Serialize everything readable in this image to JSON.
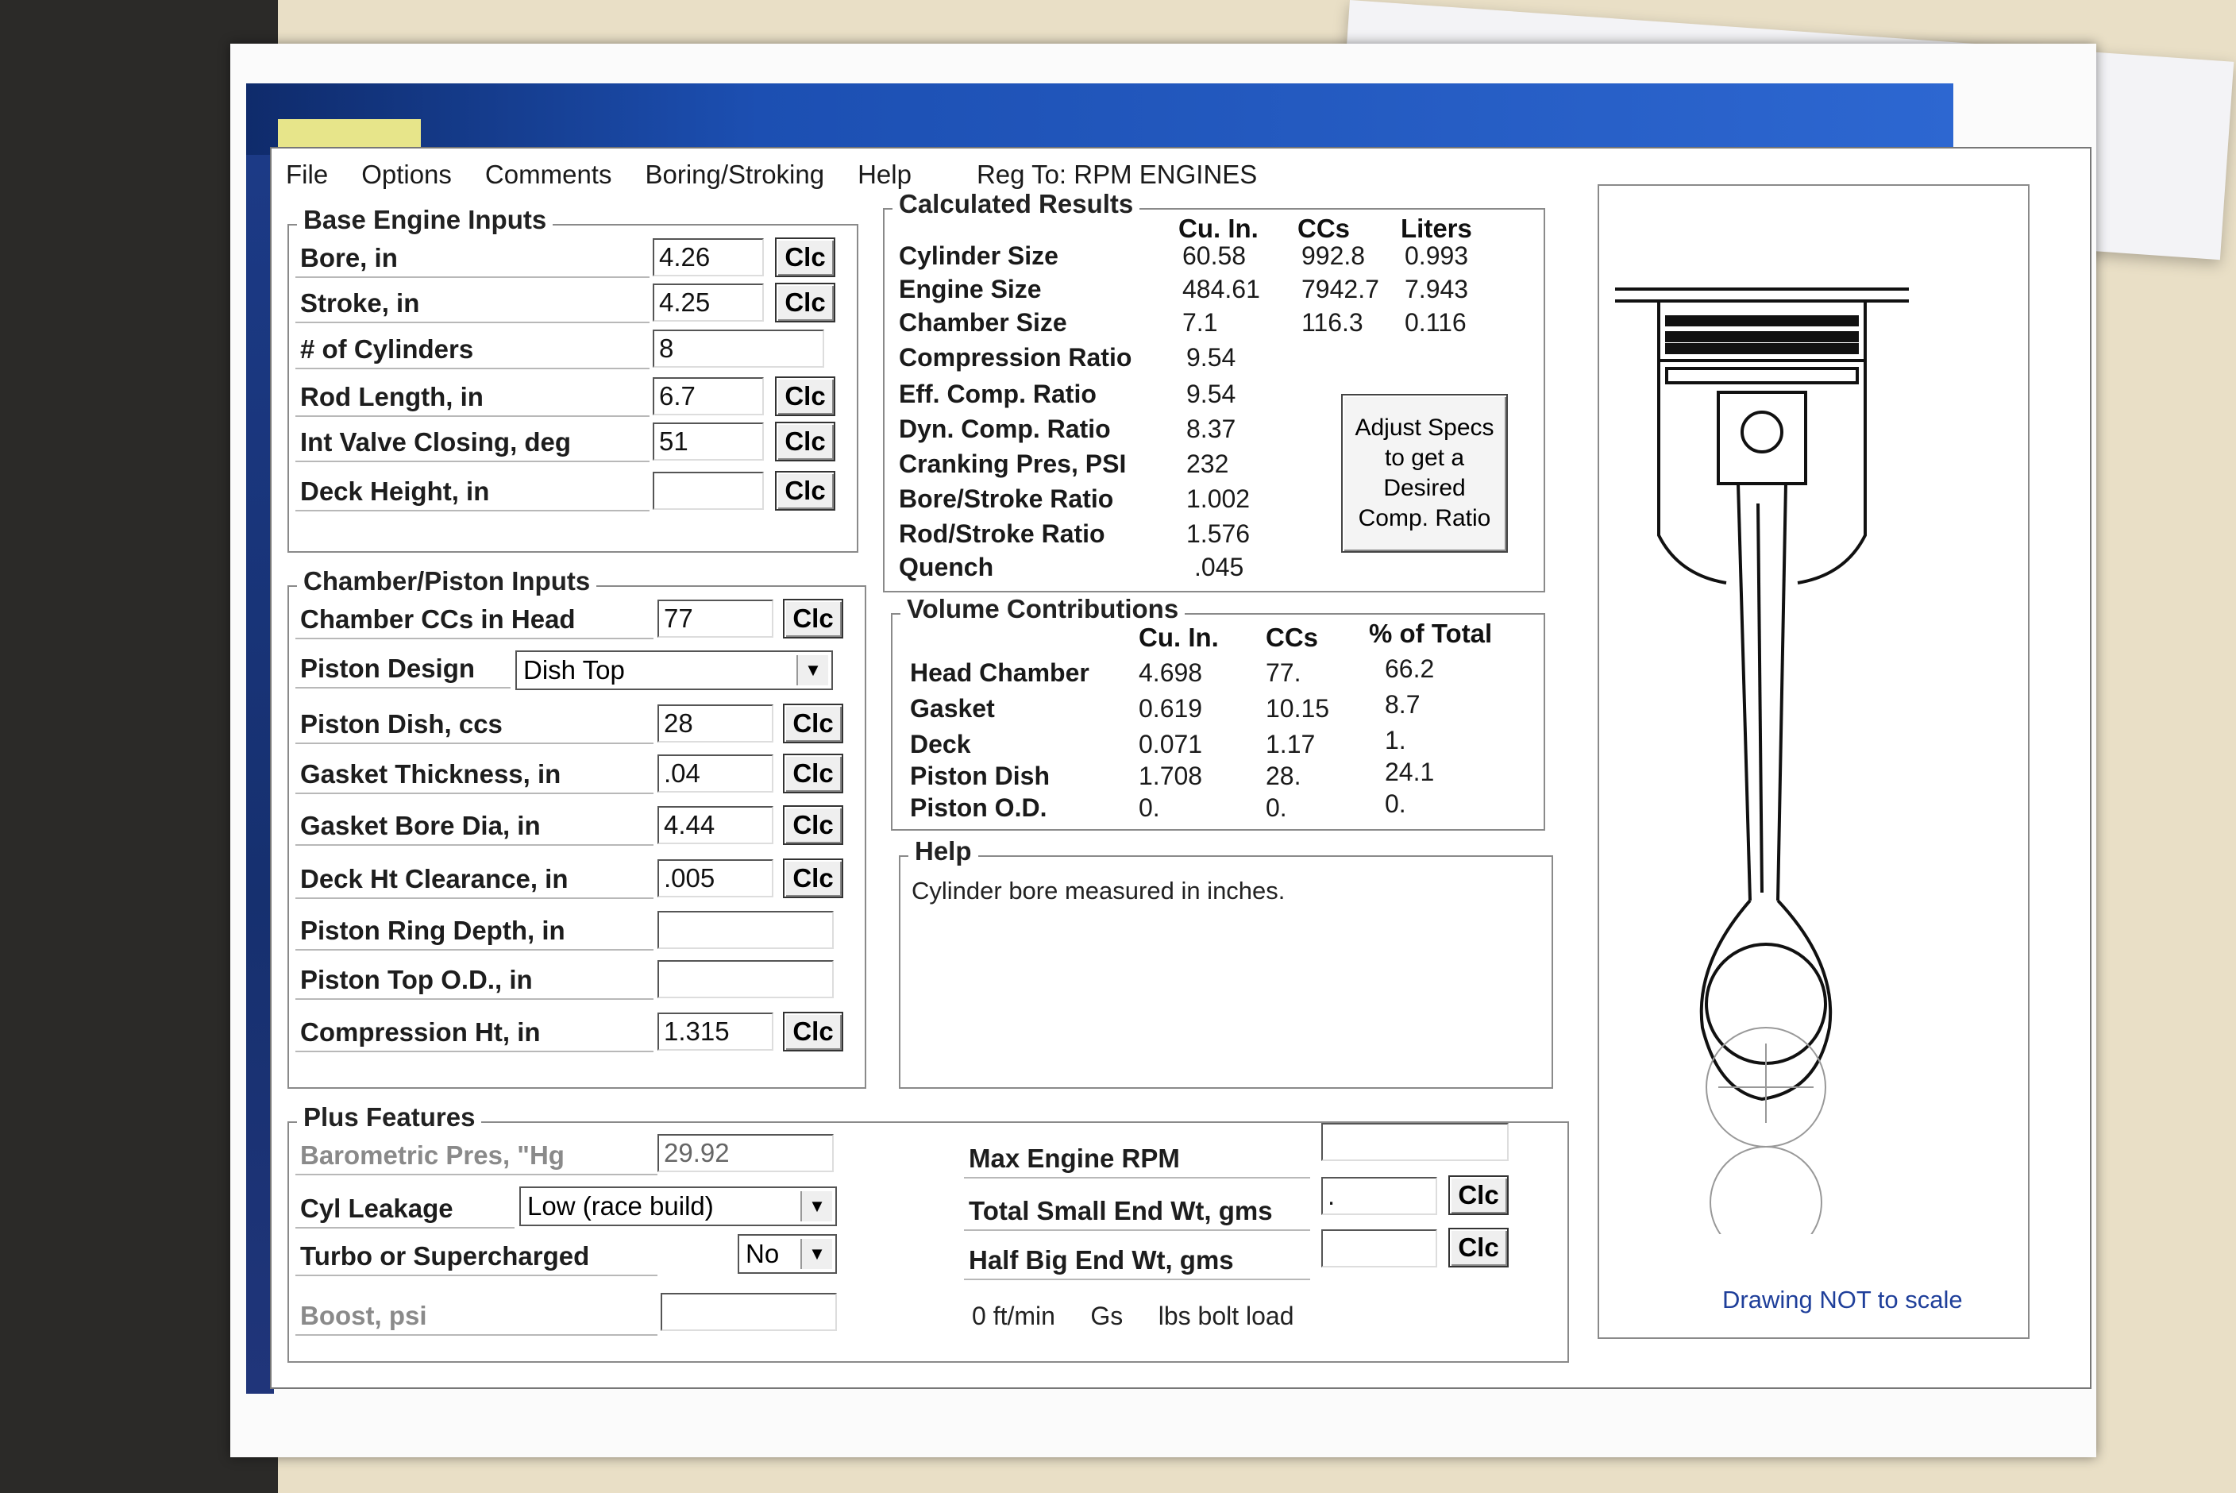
{
  "menu": {
    "file": "File",
    "options": "Options",
    "comments": "Comments",
    "boring": "Boring/Stroking",
    "help": "Help",
    "reg": "Reg To: RPM ENGINES"
  },
  "clc_label": "Clc",
  "base_inputs": {
    "title": "Base Engine Inputs",
    "bore_label": "Bore, in",
    "bore_value": "4.26",
    "stroke_label": "Stroke, in",
    "stroke_value": "4.25",
    "cyl_label": "# of Cylinders",
    "cyl_value": "8",
    "rod_label": "Rod Length, in",
    "rod_value": "6.7",
    "ivc_label": "Int Valve Closing, deg",
    "ivc_value": "51",
    "deck_label": "Deck Height, in",
    "deck_value": ""
  },
  "chamber_inputs": {
    "title": "Chamber/Piston Inputs",
    "chamber_label": "Chamber CCs in Head",
    "chamber_value": "77",
    "design_label": "Piston Design",
    "design_value": "Dish Top",
    "dish_label": "Piston Dish, ccs",
    "dish_value": "28",
    "gasket_thk_label": "Gasket Thickness, in",
    "gasket_thk_value": ".04",
    "gasket_bore_label": "Gasket Bore Dia, in",
    "gasket_bore_value": "4.44",
    "deck_clear_label": "Deck Ht Clearance, in",
    "deck_clear_value": ".005",
    "ring_label": "Piston Ring Depth, in",
    "ring_value": "",
    "top_od_label": "Piston Top O.D., in",
    "top_od_value": "",
    "comp_ht_label": "Compression Ht, in",
    "comp_ht_value": "1.315"
  },
  "plus": {
    "title": "Plus Features",
    "baro_label": "Barometric Pres, \"Hg",
    "baro_value": "29.92",
    "leak_label": "Cyl Leakage",
    "leak_value": "Low (race build)",
    "turbo_label": "Turbo or Supercharged",
    "turbo_value": "No",
    "boost_label": "Boost, psi",
    "boost_value": "",
    "rpm_label": "Max Engine RPM",
    "rpm_value": "",
    "small_end_label": "Total Small End Wt, gms",
    "small_end_value": ".",
    "big_end_label": "Half Big End Wt, gms",
    "big_end_value": "",
    "footer": "0 ft/min     Gs     lbs bolt load"
  },
  "calc": {
    "title": "Calculated Results",
    "col_cuin": "Cu. In.",
    "col_ccs": "CCs",
    "col_liters": "Liters",
    "rows": [
      {
        "label": "Cylinder Size",
        "cuin": "60.58",
        "ccs": "992.8",
        "liters": "0.993"
      },
      {
        "label": "Engine Size",
        "cuin": "484.61",
        "ccs": "7942.7",
        "liters": "7.943"
      },
      {
        "label": "Chamber Size",
        "cuin": "7.1",
        "ccs": "116.3",
        "liters": "0.116"
      }
    ],
    "single": [
      {
        "label": "Compression Ratio",
        "value": "9.54"
      },
      {
        "label": "Eff. Comp. Ratio",
        "value": "9.54"
      },
      {
        "label": "Dyn. Comp. Ratio",
        "value": "8.37"
      },
      {
        "label": "Cranking Pres, PSI",
        "value": "232"
      },
      {
        "label": "Bore/Stroke Ratio",
        "value": "1.002"
      },
      {
        "label": "Rod/Stroke Ratio",
        "value": "1.576"
      },
      {
        "label": "Quench",
        "value": ".045"
      }
    ],
    "adjust_button": "Adjust Specs to get a Desired Comp. Ratio"
  },
  "volume": {
    "title": "Volume Contributions",
    "col_cuin": "Cu. In.",
    "col_ccs": "CCs",
    "col_pct": "% of Total",
    "rows": [
      {
        "label": "Head Chamber",
        "cuin": "4.698",
        "ccs": "77.",
        "pct": "66.2"
      },
      {
        "label": "Gasket",
        "cuin": "0.619",
        "ccs": "10.15",
        "pct": "8.7"
      },
      {
        "label": "Deck",
        "cuin": "0.071",
        "ccs": "1.17",
        "pct": "1."
      },
      {
        "label": "Piston Dish",
        "cuin": "1.708",
        "ccs": "28.",
        "pct": "24.1"
      },
      {
        "label": "Piston O.D.",
        "cuin": "0.",
        "ccs": "0.",
        "pct": "0."
      }
    ]
  },
  "help": {
    "title": "Help",
    "text": "Cylinder bore measured in inches."
  },
  "drawing": {
    "note": "Drawing NOT to scale"
  }
}
